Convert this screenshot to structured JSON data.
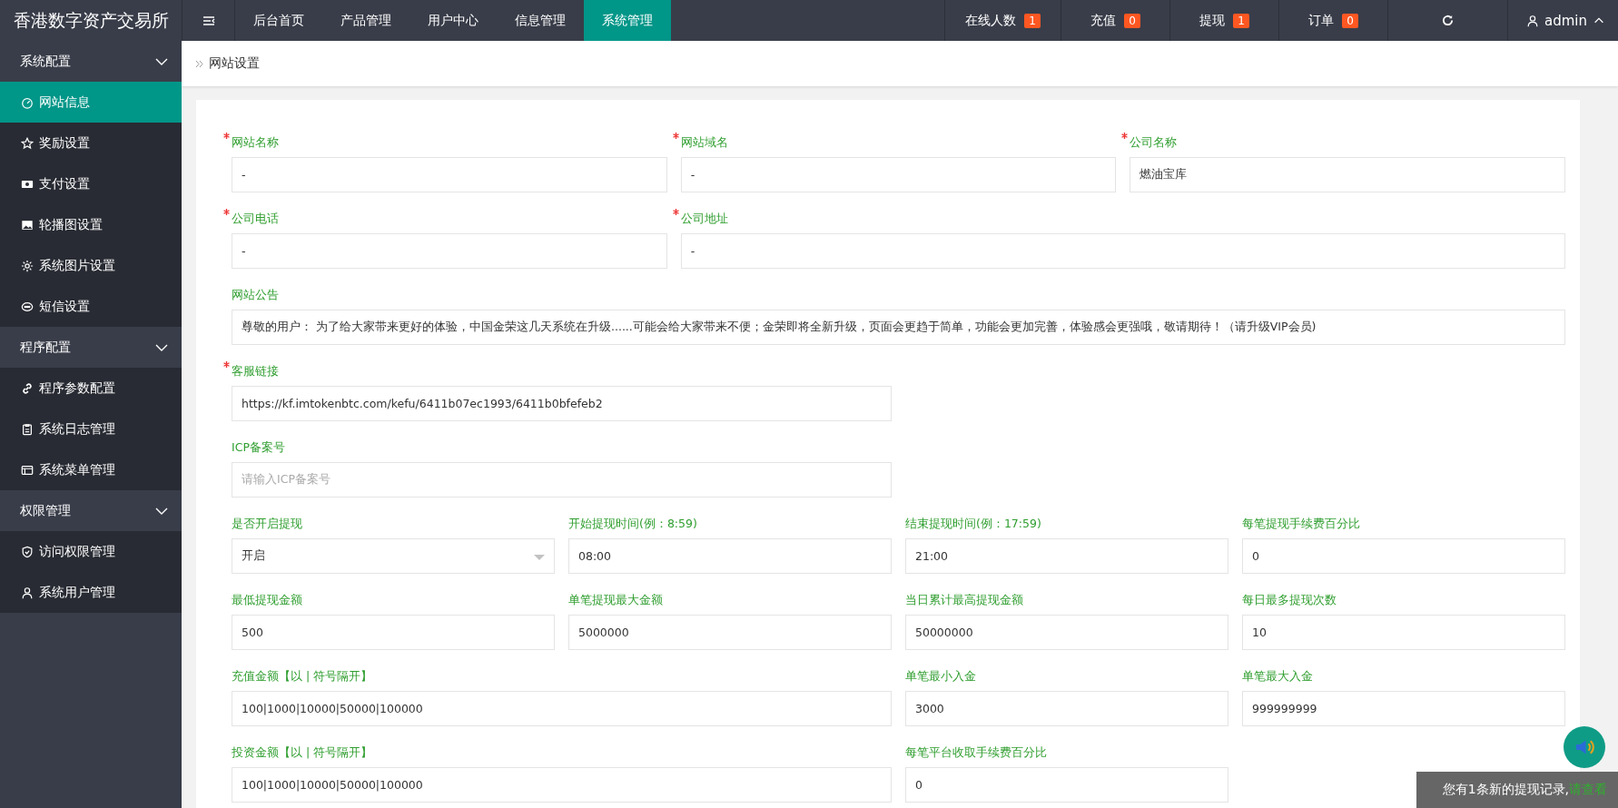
{
  "app": {
    "title": "香港数字资产交易所"
  },
  "topnav": {
    "tabs": [
      {
        "label": "后台首页",
        "selected": false
      },
      {
        "label": "产品管理",
        "selected": false
      },
      {
        "label": "用户中心",
        "selected": false
      },
      {
        "label": "信息管理",
        "selected": false
      },
      {
        "label": "系统管理",
        "selected": true
      }
    ],
    "stats": [
      {
        "label": "在线人数",
        "count": "1"
      },
      {
        "label": "充值",
        "count": "0"
      },
      {
        "label": "提现",
        "count": "1"
      },
      {
        "label": "订单",
        "count": "0"
      }
    ],
    "user": "admin"
  },
  "sidebar": {
    "groups": [
      {
        "label": "系统配置",
        "expanded": true,
        "items": [
          {
            "label": "网站信息",
            "selected": true
          },
          {
            "label": "奖励设置",
            "selected": false
          },
          {
            "label": "支付设置",
            "selected": false
          },
          {
            "label": "轮播图设置",
            "selected": false
          },
          {
            "label": "系统图片设置",
            "selected": false
          },
          {
            "label": "短信设置",
            "selected": false
          }
        ]
      },
      {
        "label": "程序配置",
        "expanded": true,
        "items": [
          {
            "label": "程序参数配置",
            "selected": false
          },
          {
            "label": "系统日志管理",
            "selected": false
          },
          {
            "label": "系统菜单管理",
            "selected": false
          }
        ]
      },
      {
        "label": "权限管理",
        "expanded": true,
        "items": [
          {
            "label": "访问权限管理",
            "selected": false
          },
          {
            "label": "系统用户管理",
            "selected": false
          }
        ]
      }
    ]
  },
  "breadcrumb": "网站设置",
  "form": {
    "fields": [
      {
        "label": "网站名称",
        "required": true,
        "kind": "text",
        "value": "-"
      },
      {
        "label": "网站域名",
        "required": true,
        "kind": "text",
        "value": "-"
      },
      {
        "label": "公司名称",
        "required": true,
        "kind": "text",
        "value": "燃油宝库"
      },
      {
        "label": "公司电话",
        "required": true,
        "kind": "text",
        "value": "-"
      },
      {
        "label": "公司地址",
        "required": true,
        "kind": "text",
        "value": "-"
      },
      {
        "label": "网站公告",
        "required": false,
        "kind": "text",
        "value": "尊敬的用户： 为了给大家带来更好的体验，中国金荣这几天系统在升级......可能会给大家带来不便；金荣即将全新升级，页面会更趋于简单，功能会更加完善，体验感会更强哦，敬请期待！（请升级VIP会员)"
      },
      {
        "label": "客服链接",
        "required": true,
        "kind": "text",
        "value": "https://kf.imtokenbtc.com/kefu/6411b07ec1993/6411b0bfefeb2"
      },
      {
        "label": "ICP备案号",
        "required": false,
        "kind": "text",
        "placeholder": "请输入ICP备案号"
      },
      {
        "label": "是否开启提现",
        "required": false,
        "kind": "select",
        "value": "开启"
      },
      {
        "label": "开始提现时间(例：8:59)",
        "required": false,
        "kind": "text",
        "value": "08:00"
      },
      {
        "label": "结束提现时间(例：17:59)",
        "required": false,
        "kind": "text",
        "value": "21:00"
      },
      {
        "label": "每笔提现手续费百分比",
        "required": false,
        "kind": "text",
        "value": "0"
      },
      {
        "label": "最低提现金额",
        "required": false,
        "kind": "text",
        "value": "500"
      },
      {
        "label": "单笔提现最大金额",
        "required": false,
        "kind": "text",
        "value": "5000000"
      },
      {
        "label": "当日累计最高提现金额",
        "required": false,
        "kind": "text",
        "value": "50000000"
      },
      {
        "label": "每日最多提现次数",
        "required": false,
        "kind": "text",
        "value": "10"
      },
      {
        "label": "充值金额【以 | 符号隔开】",
        "required": false,
        "kind": "text",
        "value": "100|1000|10000|50000|100000"
      },
      {
        "label": "单笔最小入金",
        "required": false,
        "kind": "text",
        "value": "3000"
      },
      {
        "label": "单笔最大入金",
        "required": false,
        "kind": "text",
        "value": "999999999"
      },
      {
        "label": "投资金额【以 | 符号隔开】",
        "required": false,
        "kind": "text",
        "value": "100|1000|10000|50000|100000"
      },
      {
        "label": "每笔平台收取手续费百分比",
        "required": false,
        "kind": "text",
        "value": "0"
      }
    ]
  },
  "toast": {
    "message": "您有1条新的提现记录,",
    "link": "请查看"
  }
}
